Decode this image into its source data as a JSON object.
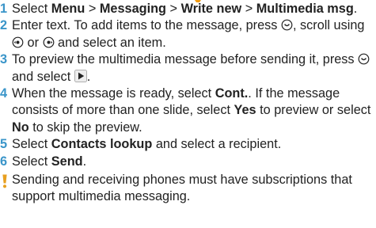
{
  "steps": [
    {
      "num": "1",
      "t1": "Select ",
      "b1": "Menu",
      "t2": " > ",
      "b2": "Messaging",
      "t3": " > ",
      "b3": "Write new",
      "t4": " > ",
      "b4": "Multimedia msg",
      "t5": "."
    },
    {
      "num": "2",
      "t1": "Enter text. To add items to the message, press ",
      "t2": ", scroll using ",
      "t3": " or ",
      "t4": " and select an item."
    },
    {
      "num": "3",
      "t1": "To preview the multimedia message before sending it, press ",
      "t2": " and select ",
      "t3": "."
    },
    {
      "num": "4",
      "t1": "When the message is ready, select ",
      "b1": "Cont.",
      "t2": ". If the message consists of more than one slide, select ",
      "b2": "Yes",
      "t3": " to preview or select ",
      "b3": "No",
      "t4": " to skip the preview."
    },
    {
      "num": "5",
      "t1": "Select ",
      "b1": "Contacts lookup",
      "t2": " and select a recipient."
    },
    {
      "num": "6",
      "t1": "Select ",
      "b1": "Send",
      "t2": "."
    }
  ],
  "note": "Sending and receiving phones must have subscriptions that support multimedia messaging.",
  "colors": {
    "step_number": "#3a95c9",
    "warning": "#e8a020",
    "accent": "#f39c12"
  },
  "icons": [
    "center-select-key-icon",
    "navigation-key-left-icon",
    "navigation-key-right-icon",
    "play-icon",
    "warning-icon"
  ]
}
